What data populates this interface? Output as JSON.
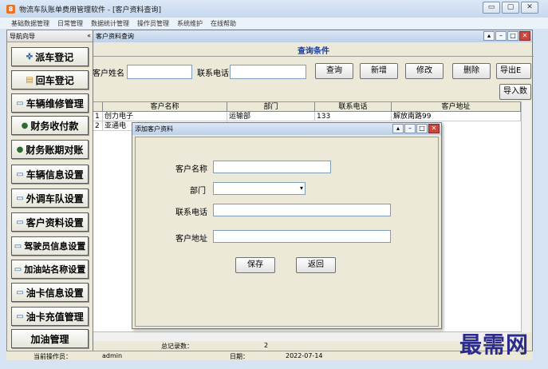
{
  "window": {
    "app_badge": "8",
    "title": "物流车队账单费用管理软件  - [客户资料查询]",
    "buttons": [
      "▭",
      "▢",
      "✕"
    ]
  },
  "menu": [
    "基础数据管理",
    "日常管理",
    "数据统计管理",
    "操作员管理",
    "系统维护",
    "在线帮助"
  ],
  "sidebar": {
    "header": "导航向导",
    "collapse": "«",
    "items": [
      {
        "label": "派车登记",
        "icon": "dispatch-icon"
      },
      {
        "label": "回车登记",
        "icon": "return-icon"
      },
      {
        "label": "车辆维修管理",
        "icon": "repair-icon"
      },
      {
        "label": "财务收付款",
        "icon": "money-bag-icon"
      },
      {
        "label": "财务账期对账",
        "icon": "money-bag-icon"
      },
      {
        "label": "车辆信息设置",
        "icon": "form-icon"
      },
      {
        "label": "外调车队设置",
        "icon": "form-icon"
      },
      {
        "label": "客户资料设置",
        "icon": "form-icon"
      },
      {
        "label": "驾驶员信息设置",
        "icon": "form-icon"
      },
      {
        "label": "加油站名称设置",
        "icon": "form-icon"
      },
      {
        "label": "油卡信息设置",
        "icon": "form-icon"
      },
      {
        "label": "油卡充值管理",
        "icon": "form-icon"
      },
      {
        "label": "加油管理",
        "icon": ""
      }
    ]
  },
  "query_window": {
    "title": "客户资料查询",
    "section_title": "查询条件",
    "customer_name_label": "客户姓名",
    "phone_label": "联系电话",
    "buttons": {
      "query": "查询",
      "add": "新增",
      "edit": "修改",
      "delete": "删除",
      "export": "导出E",
      "import": "导入数"
    },
    "grid": {
      "columns": [
        "客户名称",
        "部门",
        "联系电话",
        "客户地址"
      ],
      "rows": [
        {
          "num": "1",
          "name": "创力电子",
          "dept": "运输部",
          "phone": "133",
          "address": "解放南路99"
        },
        {
          "num": "2",
          "name": "亚通电",
          "dept": "",
          "phone": "",
          "address": ""
        }
      ]
    },
    "total_label": "总记录数：",
    "total_value": "2"
  },
  "dialog": {
    "title": "添加客户资料",
    "fields": {
      "name": "客户名称",
      "dept": "部门",
      "phone": "联系电话",
      "address": "客户地址"
    },
    "save": "保存",
    "back": "返回"
  },
  "status_bar": {
    "operator_label": "当前操作员：",
    "operator": "admin",
    "date_label": "日期：",
    "date": "2022-07-14"
  },
  "watermark": "最需网"
}
